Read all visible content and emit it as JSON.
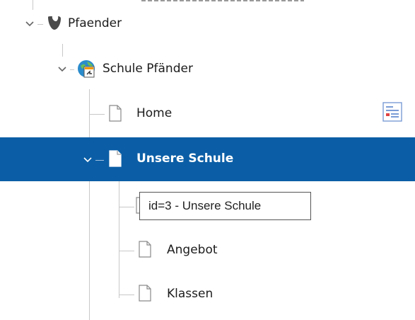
{
  "tree": {
    "items": [
      {
        "label": "Pfaender",
        "icon": "typo3-logo-icon",
        "expanded": true
      },
      {
        "label": "Schule Pfänder",
        "icon": "site-root-icon",
        "expanded": true
      },
      {
        "label": "Home",
        "icon": "page-icon"
      },
      {
        "label": "Unsere Schule",
        "icon": "page-icon",
        "expanded": true,
        "selected": true
      },
      {
        "label": "",
        "icon": "page-icon"
      },
      {
        "label": "Angebot",
        "icon": "page-icon"
      },
      {
        "label": "Klassen",
        "icon": "page-icon"
      }
    ]
  },
  "tooltip": {
    "text": "id=3 - Unsere Schule"
  },
  "colors": {
    "selection": "#0b5ea6",
    "typo3_orange": "#f49700",
    "tree_line": "#c8c8c8"
  }
}
